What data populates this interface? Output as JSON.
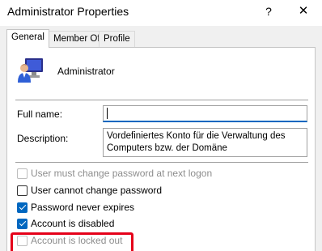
{
  "window": {
    "title": "Administrator Properties",
    "help_glyph": "?",
    "close_glyph": "✕"
  },
  "tabs": [
    {
      "label": "General",
      "active": true
    },
    {
      "label": "Member Of",
      "active": false
    },
    {
      "label": "Profile",
      "active": false
    }
  ],
  "user": {
    "name": "Administrator",
    "icon": "user-monitor-icon"
  },
  "form": {
    "full_name_label": "Full name:",
    "full_name_value": "",
    "description_label": "Description:",
    "description_value": "Vordefiniertes Konto für die Verwaltung des\nComputers bzw. der Domäne"
  },
  "options": [
    {
      "label": "User must change password at next logon",
      "checked": false,
      "enabled": false
    },
    {
      "label": "User cannot change password",
      "checked": false,
      "enabled": true
    },
    {
      "label": "Password never expires",
      "checked": true,
      "enabled": true
    },
    {
      "label": "Account is disabled",
      "checked": true,
      "enabled": true
    },
    {
      "label": "Account is locked out",
      "checked": false,
      "enabled": false
    }
  ],
  "colors": {
    "accent": "#0067c0",
    "highlight": "#e50019"
  }
}
